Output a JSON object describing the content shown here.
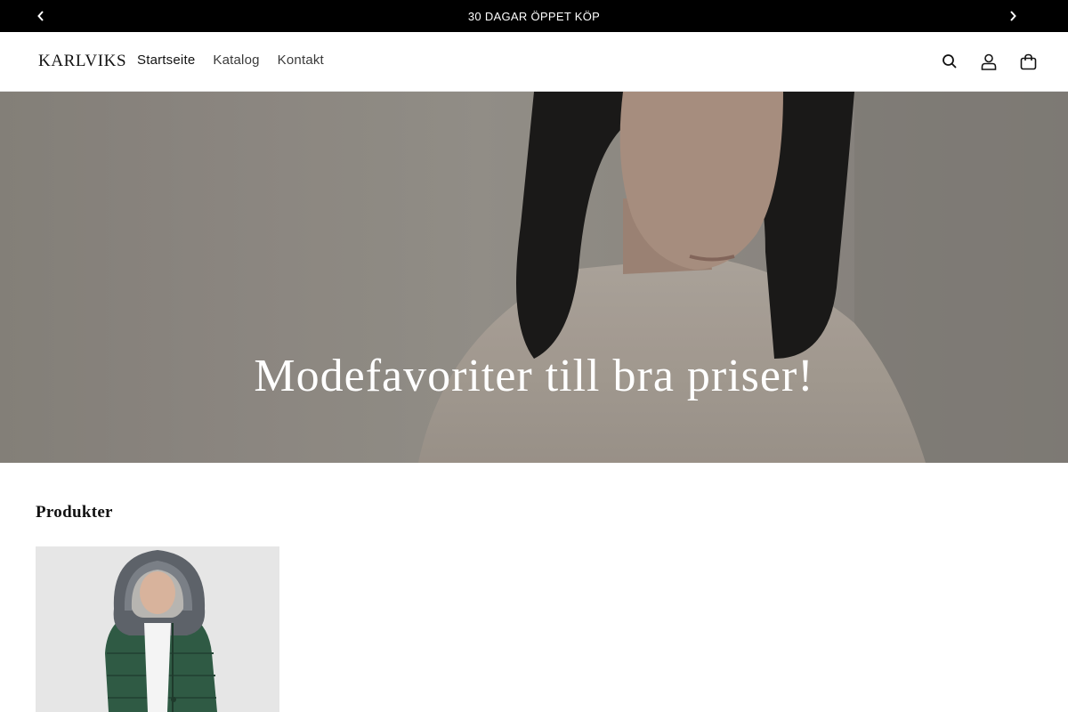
{
  "announcement": {
    "text": "30 DAGAR ÖPPET KÖP"
  },
  "header": {
    "logo": "KARLVIKS",
    "nav": [
      {
        "label": "Startseite"
      },
      {
        "label": "Katalog"
      },
      {
        "label": "Kontakt"
      }
    ],
    "icons": [
      "search-icon",
      "account-icon",
      "cart-icon"
    ]
  },
  "hero": {
    "title": "Modefavoriter till bra priser!"
  },
  "products": {
    "heading": "Produkter"
  },
  "colors": {
    "announcement_bg": "#000000",
    "text": "#121212",
    "card_bg": "#e6e6e6",
    "jacket": "#2f5a44"
  }
}
